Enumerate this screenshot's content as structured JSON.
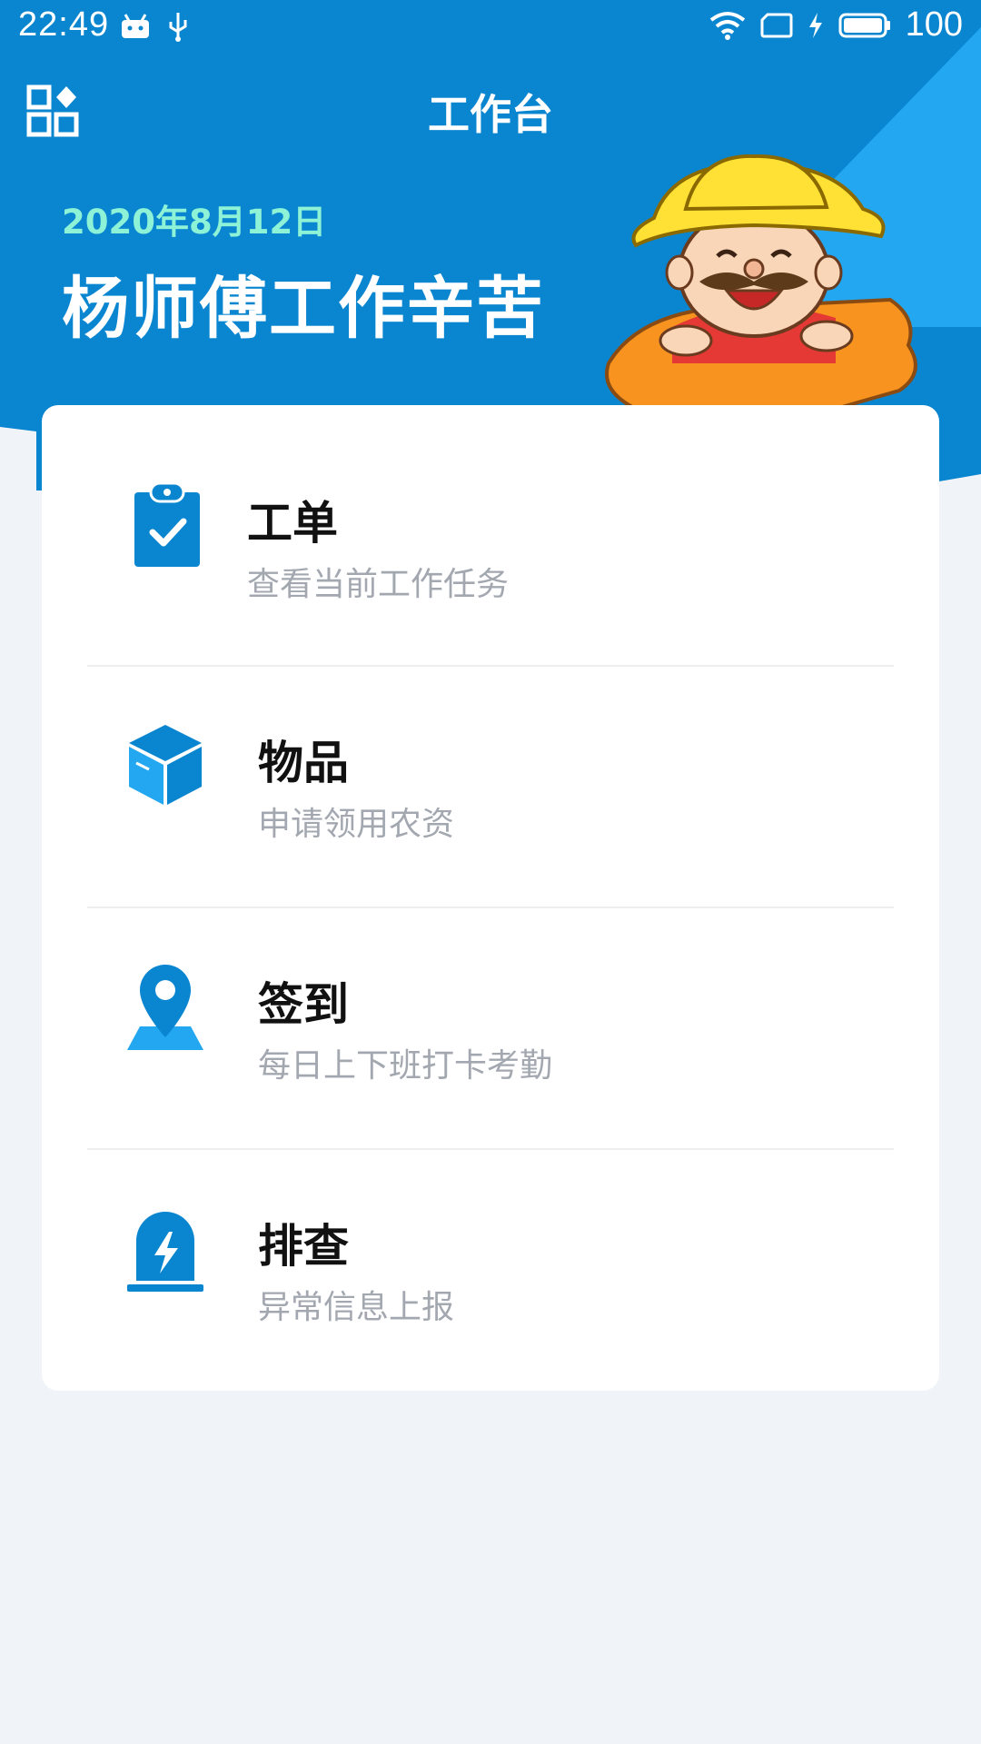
{
  "status": {
    "time": "22:49",
    "battery": "100"
  },
  "header": {
    "title": "工作台",
    "date": "2020年8月12日",
    "greeting": "杨师傅工作辛苦"
  },
  "menu": [
    {
      "title": "工单",
      "subtitle": "查看当前工作任务",
      "icon": "clipboard-check-icon"
    },
    {
      "title": "物品",
      "subtitle": "申请领用农资",
      "icon": "box-icon"
    },
    {
      "title": "签到",
      "subtitle": "每日上下班打卡考勤",
      "icon": "location-pin-icon"
    },
    {
      "title": "排查",
      "subtitle": "异常信息上报",
      "icon": "alarm-light-icon"
    }
  ],
  "colors": {
    "primary": "#0A86D1",
    "accent_light": "#22A7F0",
    "date_text": "#8DF2D6",
    "page_bg": "#F0F4F9"
  }
}
